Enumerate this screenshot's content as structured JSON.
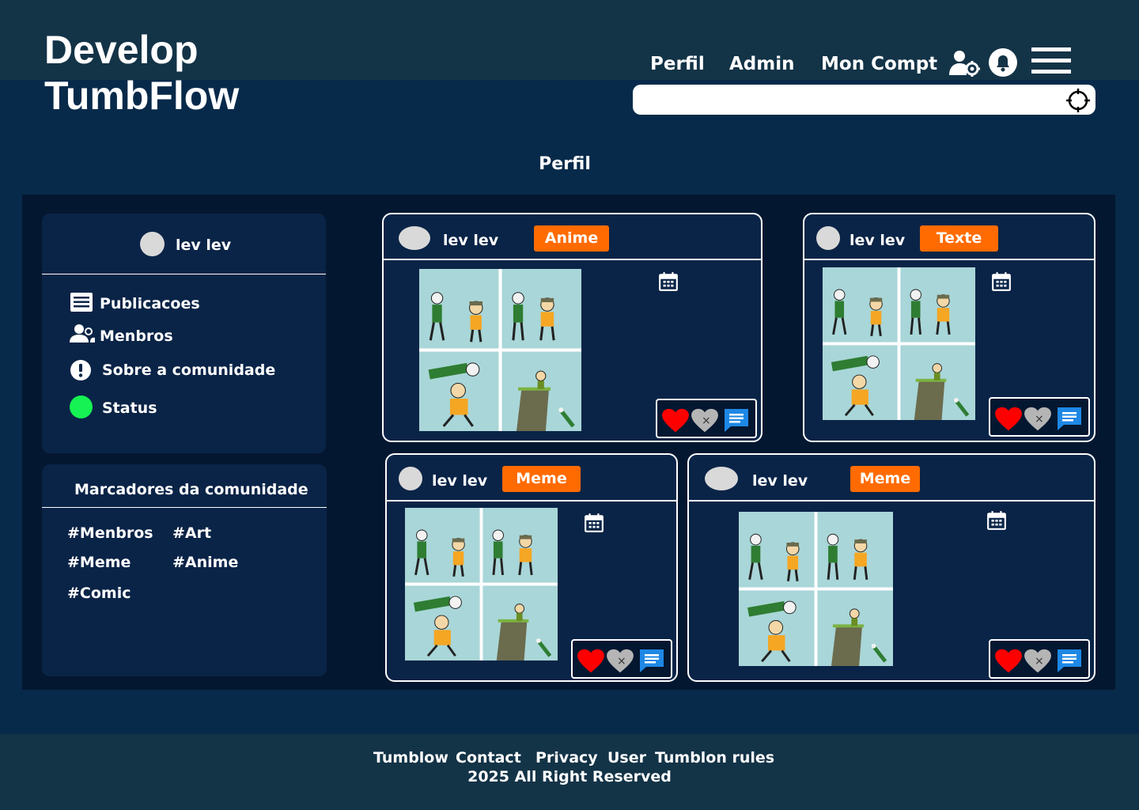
{
  "app": {
    "title_line1": "Develop",
    "title_line2": "TumbFlow"
  },
  "nav": {
    "perfil": "Perfil",
    "admin": "Admin",
    "account": "Mon Compt",
    "icons": [
      "user-settings-icon",
      "bell-icon",
      "hamburger-menu-icon"
    ]
  },
  "search": {
    "value": "",
    "placeholder": "",
    "icon": "crosshair-icon"
  },
  "page_title": "Perfil",
  "profile": {
    "username": "lev lev",
    "menu": [
      {
        "label": "Publicacoes",
        "icon": "list-icon"
      },
      {
        "label": "Menbros",
        "icon": "users-icon"
      },
      {
        "label": "Sobre a comunidade",
        "icon": "info-icon"
      },
      {
        "label": "Status",
        "icon": "status-dot",
        "color": "#16f253"
      }
    ]
  },
  "tags": {
    "title": "Marcadores  da comunidade",
    "items": [
      "#Menbros",
      "#Art",
      "#Meme",
      "#Anime",
      "#Comic"
    ]
  },
  "posts": [
    {
      "user": "lev lev",
      "category": "Anime"
    },
    {
      "user": "lev lev",
      "category": "Texte"
    },
    {
      "user": "lev lev",
      "category": "Meme"
    },
    {
      "user": "lev lev",
      "category": "Meme"
    }
  ],
  "post_actions": [
    "heart-icon",
    "broken-heart-icon",
    "comment-icon"
  ],
  "colors": {
    "background": "#082a4a",
    "topbar": "#133347",
    "content_bg": "#041730",
    "panel": "#0a2447",
    "badge": "#ff6b00",
    "heart": "#ff0000",
    "comment": "#1e88e5"
  },
  "footer": {
    "links": [
      "Tumblow",
      "Contact",
      "Privacy",
      "User",
      "Tumblon rules"
    ],
    "copyright": "2025 All Right Reserved"
  }
}
